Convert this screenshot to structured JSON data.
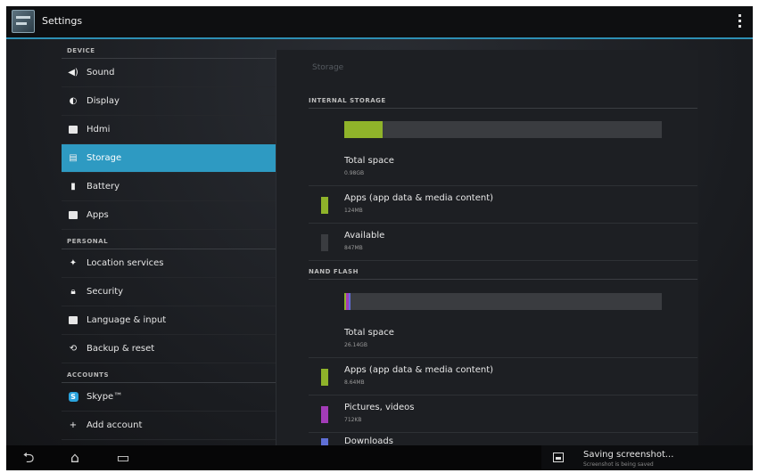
{
  "app": {
    "title": "Settings"
  },
  "sidebar": {
    "sections": [
      {
        "header": "DEVICE",
        "items": [
          {
            "label": "Sound",
            "icon": "speaker-icon"
          },
          {
            "label": "Display",
            "icon": "display-icon"
          },
          {
            "label": "Hdmi",
            "icon": "hdmi-icon"
          },
          {
            "label": "Storage",
            "icon": "storage-icon",
            "active": true
          },
          {
            "label": "Battery",
            "icon": "battery-icon"
          },
          {
            "label": "Apps",
            "icon": "apps-icon"
          }
        ]
      },
      {
        "header": "PERSONAL",
        "items": [
          {
            "label": "Location services",
            "icon": "location-icon"
          },
          {
            "label": "Security",
            "icon": "lock-icon"
          },
          {
            "label": "Language & input",
            "icon": "keyboard-icon"
          },
          {
            "label": "Backup & reset",
            "icon": "backup-icon"
          }
        ]
      },
      {
        "header": "ACCOUNTS",
        "items": [
          {
            "label": "Skype™",
            "icon": "skype-icon"
          },
          {
            "label": "Add account",
            "icon": "plus-icon"
          }
        ]
      }
    ]
  },
  "storage": {
    "title": "Storage",
    "internal": {
      "header": "INTERNAL STORAGE",
      "used_fraction": 0.12,
      "total": {
        "label": "Total space",
        "value": "0.98GB"
      },
      "apps": {
        "label": "Apps (app data & media content)",
        "value": "124MB",
        "color": "#8fb32a"
      },
      "available": {
        "label": "Available",
        "value": "847MB",
        "color": "#3a3c40"
      }
    },
    "nand": {
      "header": "NAND FLASH",
      "segments": [
        {
          "fraction": 0.006,
          "color": "#8fb32a"
        },
        {
          "fraction": 0.008,
          "color": "#a33cb8"
        },
        {
          "fraction": 0.006,
          "color": "#5f6fd6"
        }
      ],
      "total": {
        "label": "Total space",
        "value": "26.14GB"
      },
      "apps": {
        "label": "Apps (app data & media content)",
        "value": "8.64MB",
        "color": "#8fb32a"
      },
      "pictures": {
        "label": "Pictures, videos",
        "value": "712KB",
        "color": "#a33cb8"
      },
      "downloads": {
        "label": "Downloads",
        "color": "#5f6fd6"
      }
    }
  },
  "notification": {
    "title": "Saving screenshot...",
    "subtitle": "Screenshot is being saved"
  }
}
